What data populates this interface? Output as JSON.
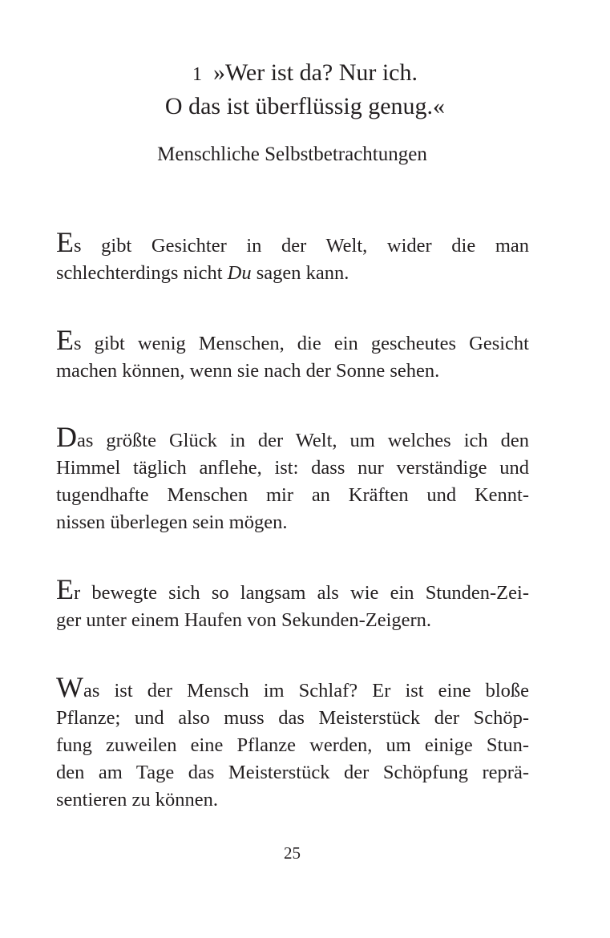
{
  "chapter": {
    "number": "1",
    "title_line1": "»Wer ist da? Nur ich.",
    "title_line2": "O das ist überflüssig genug.«",
    "subtitle": "Menschliche Selbstbetrachtungen"
  },
  "aphorisms": [
    {
      "initial": "E",
      "lines": [
        "s gibt Gesichter in der Welt, wider die man",
        "schlechterdings nicht ",
        "Du",
        " sagen kann."
      ]
    },
    {
      "initial": "E",
      "lines": [
        "s gibt wenig Menschen, die ein gescheutes Gesicht",
        "machen können, wenn sie nach der Sonne sehen."
      ]
    },
    {
      "initial": "D",
      "lines": [
        "as größte Glück in der Welt, um welches ich den",
        "Himmel täglich anflehe, ist: dass nur verständige und",
        "tugendhafte Menschen mir an Kräften und Kennt-",
        "nissen überlegen sein mögen."
      ]
    },
    {
      "initial": "E",
      "lines": [
        "r bewegte sich so langsam als wie ein Stunden-Zei-",
        "ger unter einem Haufen von Sekunden-Zeigern."
      ]
    },
    {
      "initial": "W",
      "lines": [
        "as ist der Mensch im Schlaf? Er ist eine bloße",
        "Pflanze; und also muss das Meisterstück der Schöp-",
        "fung zuweilen eine Pflanze werden, um einige Stun-",
        "den am Tage das Meisterstück der Schöpfung reprä-",
        "sentieren zu können."
      ]
    }
  ],
  "page_number": "25"
}
